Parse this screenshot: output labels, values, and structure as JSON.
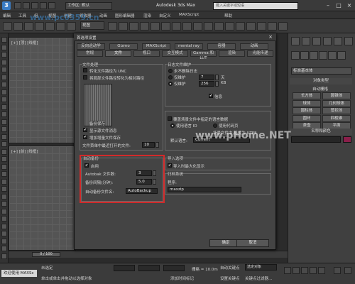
{
  "app": {
    "title": "Autodesk 3ds Max",
    "workspace": "工作区: 默认",
    "search_placeholder": "键入关键字或短语"
  },
  "menus": [
    "编辑",
    "工具",
    "组",
    "视图",
    "创建",
    "修改器",
    "动画",
    "图形编辑器",
    "渲染",
    "自定义",
    "MAXScript",
    "帮助"
  ],
  "toolbar": {
    "view_combo": "视图"
  },
  "viewports": {
    "top_label": "[+] [顶] [线框]",
    "bottom_label": "[+] [前] [线框]"
  },
  "dialog": {
    "title": "首选项设置",
    "tabs_row1": [
      "常规",
      "文件",
      "视口",
      "交互模式",
      "Gamma 和 LUT",
      "渲染",
      "光能传递"
    ],
    "tabs_row2": [
      "反向运动学",
      "Gizmo",
      "MAXScript",
      "mental ray",
      "容器",
      "动画"
    ],
    "active_tab": "文件",
    "file_handling": {
      "title": "文件处理",
      "convert_unc": "转化文件路径为 UNC",
      "convert_local": "将局部文件路径转化为相对路径",
      "backup_label": "备份保存",
      "show_xref_msgs": "显示源文件消息",
      "increment_save": "增加增量文件保存",
      "recent_files_label": "文件菜单中最近打开的文件:",
      "recent_files_value": "10"
    },
    "log_maintenance": {
      "title": "日志文件维护",
      "never_delete": "永不删除日志",
      "keep_label": "仅维护",
      "keep_days_value": "7",
      "days_unit": "天",
      "size_label": "仅维护",
      "size_value": "256",
      "size_unit": "KB",
      "info_label": "信息"
    },
    "scene_ui": {
      "line1": "覆盖场景文件中指定的语言数据",
      "use_language": "使用语言 ID",
      "use_codepage": "使用代码页",
      "save_label": "场景文件中,格式为 UTF8",
      "default_lang_label": "默认语言:",
      "default_lang_value": "Current"
    },
    "autobackup": {
      "title": "自动备份",
      "enable": "启用",
      "num_files_label": "Autobak 文件数:",
      "num_files_value": "3",
      "interval_label": "备份间隔(分钟):",
      "interval_value": "5.0",
      "filename_label": "自动备份文件名:",
      "filename_value": "AutoBackup"
    },
    "import_options": {
      "title": "导入选项",
      "zoom_extents": "导入时最大化显示"
    },
    "archive": {
      "title": "归档系统",
      "program_label": "程序:",
      "program_value": "maxzip"
    },
    "ok_label": "确定",
    "cancel_label": "取消"
  },
  "command_panel": {
    "category": "标准基本体",
    "object_type_title": "对象类型",
    "auto_grid": "自动栅格",
    "buttons": [
      "长方体",
      "圆锥体",
      "球体",
      "几何球体",
      "圆柱体",
      "管状体",
      "圆环",
      "四棱锥",
      "茶壶",
      "平面"
    ],
    "name_color_title": "名称和颜色"
  },
  "timeline": {
    "slider": "0 / 100"
  },
  "status": {
    "welcome": "欢迎使用 MAXSc",
    "prompt": "单击或单击并拖动以选择对象",
    "selected": "未选定",
    "grid": "栅格 = 10.0m",
    "auto_key": "自动关键点",
    "set_key": "设置关键点",
    "selected_obj": "选定对象",
    "key_filter": "关键点过滤器...",
    "add_time_tag": "添加时间标记"
  },
  "watermarks": {
    "site": "www.pHome.NET",
    "site_top": "www.pc0359.cn"
  },
  "colors": {
    "highlight": "#d12a2a",
    "swatch": "#8a1f4a"
  }
}
